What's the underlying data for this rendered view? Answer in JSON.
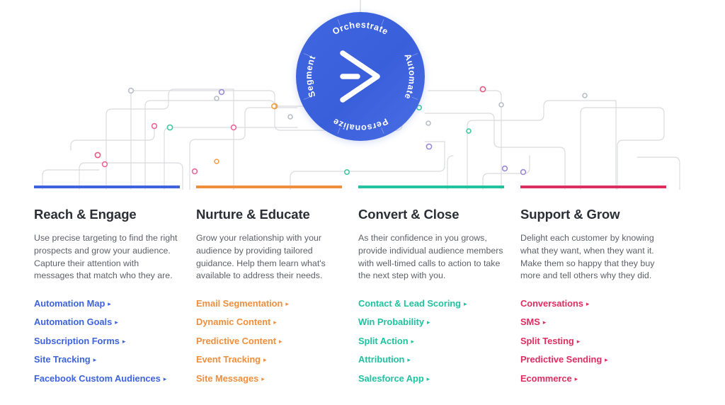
{
  "hero": {
    "brand": {
      "logo_icon": "activecampaign-chevron-logo",
      "circle_color": "#3d63dd",
      "ring_words": [
        "Orchestrate",
        "Automate",
        "Personalize",
        "Segment"
      ]
    },
    "diagram": {
      "name": "automation-circuit-diagram",
      "line_color": "#d8dade",
      "node_colors": [
        "#e8669a",
        "#f0a24a",
        "#3fc9a3",
        "#9a8ad6",
        "#b9bec6",
        "#e05c7e"
      ]
    }
  },
  "columns": [
    {
      "id": "reach-engage",
      "accent": "#3d63dd",
      "title": "Reach & Engage",
      "description": "Use precise targeting to find the right prospects and grow your audience. Capture their attention with messages that match who they are.",
      "links": [
        "Automation Map",
        "Automation Goals",
        "Subscription Forms",
        "Site Tracking",
        "Facebook Custom Audiences"
      ]
    },
    {
      "id": "nurture-educate",
      "accent": "#ef8f3d",
      "title": "Nurture & Educate",
      "description": "Grow your relationship with your audience by providing tailored guidance. Help them learn what's available to address their needs.",
      "links": [
        "Email Segmentation",
        "Dynamic Content",
        "Predictive Content",
        "Event Tracking",
        "Site Messages"
      ]
    },
    {
      "id": "convert-close",
      "accent": "#20c2a0",
      "title": "Convert & Close",
      "description": "As their confidence in you grows, provide individual audience members with well-timed calls to action to take the next step with you.",
      "links": [
        "Contact & Lead Scoring",
        "Win Probability",
        "Split Action",
        "Attribution",
        "Salesforce App"
      ]
    },
    {
      "id": "support-grow",
      "accent": "#dc2e60",
      "title": "Support & Grow",
      "description": "Delight each customer by knowing what they want, when they want it. Make them so happy that they buy more and tell others why they did.",
      "links": [
        "Conversations",
        "SMS",
        "Split Testing",
        "Predictive Sending",
        "Ecommerce"
      ]
    }
  ],
  "link_caret_glyph": "▸"
}
